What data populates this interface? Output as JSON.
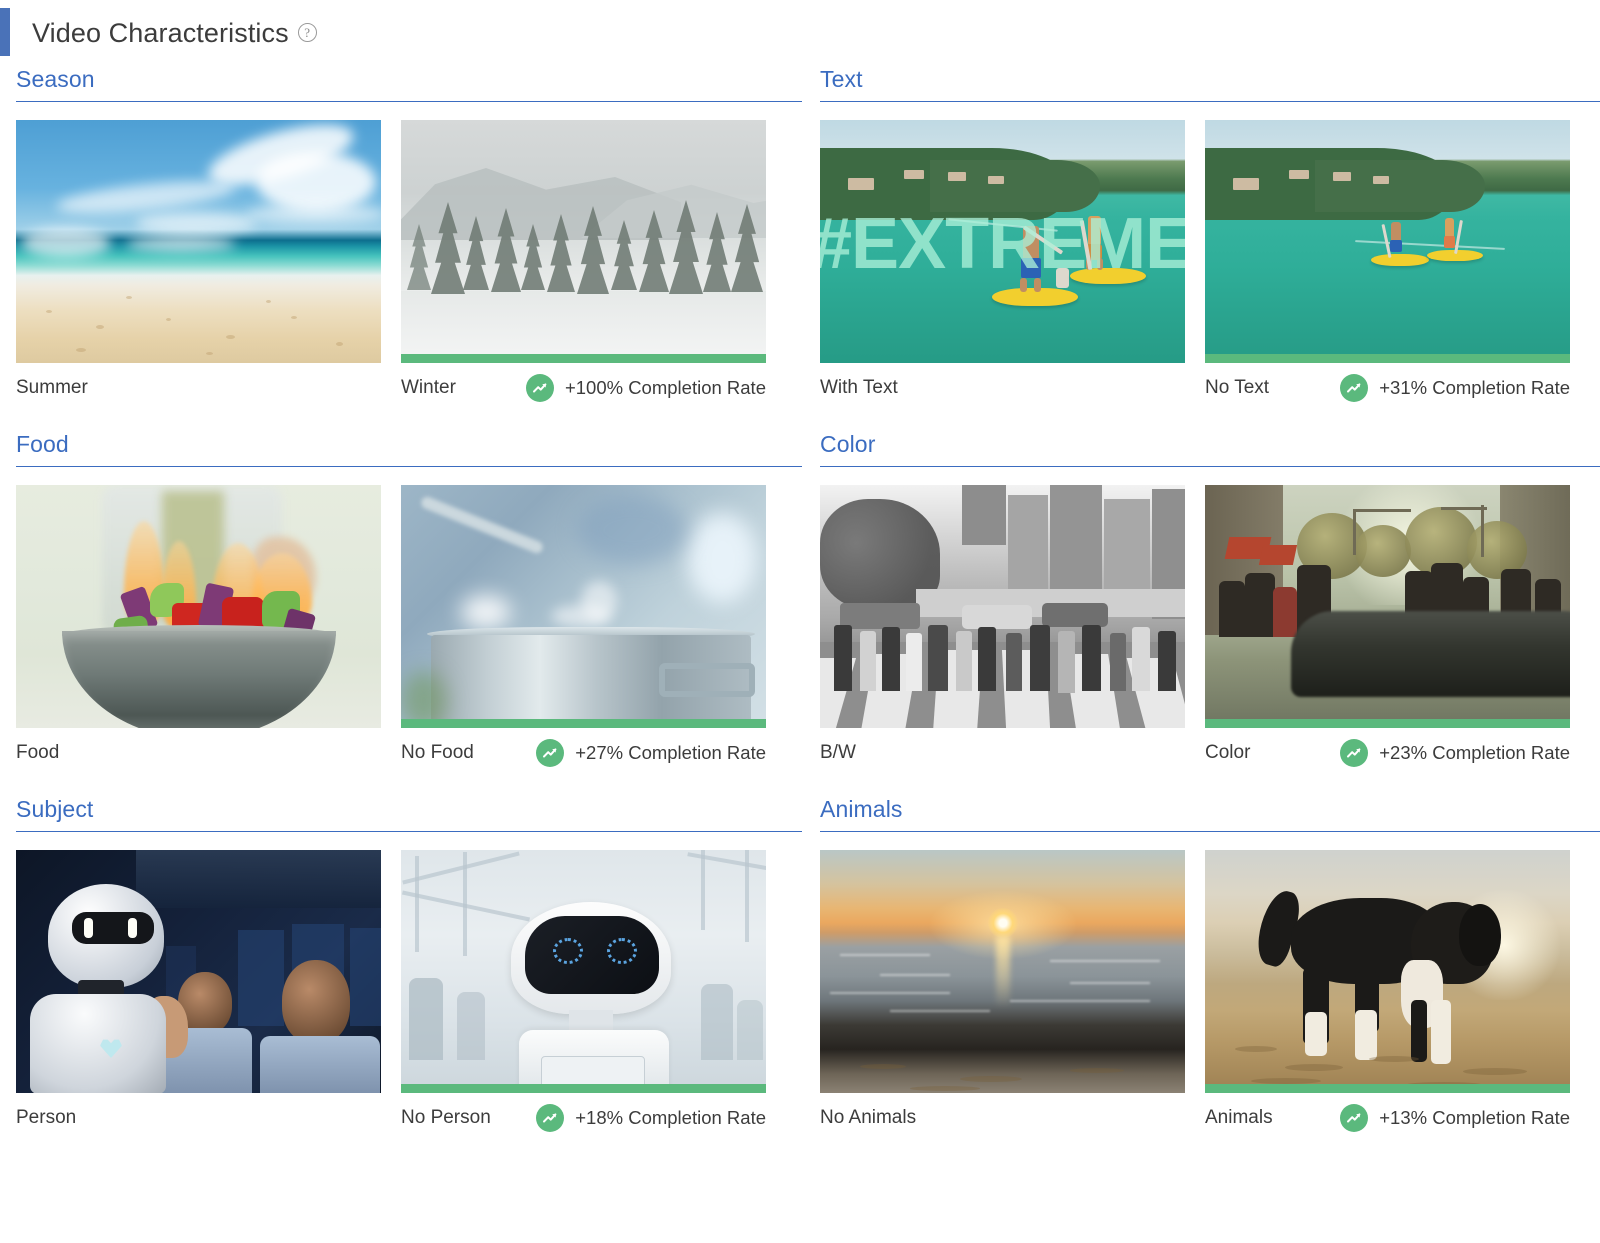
{
  "header": {
    "title": "Video Characteristics",
    "help_icon": "question-mark-icon",
    "accent_color": "#4a72b8"
  },
  "metric_suffix": "Completion Rate",
  "badge_icon": "trending-up-icon",
  "winner_bar_color": "#5bb97d",
  "section_title_color": "#3b6cc0",
  "sections": [
    {
      "id": "season",
      "title": "Season",
      "cards": [
        {
          "label": "Summer",
          "metric": "",
          "winner": false,
          "image": "beach-summer-thumbnail"
        },
        {
          "label": "Winter",
          "metric": "+100% Completion Rate",
          "winner": true,
          "image": "snowy-forest-winter-thumbnail"
        }
      ]
    },
    {
      "id": "text",
      "title": "Text",
      "cards": [
        {
          "label": "With Text",
          "metric": "",
          "winner": false,
          "image": "paddleboard-with-text-overlay-thumbnail",
          "overlay_text": "#EXTREME"
        },
        {
          "label": "No Text",
          "metric": "+31% Completion Rate",
          "winner": true,
          "image": "paddleboard-no-text-thumbnail"
        }
      ]
    },
    {
      "id": "food",
      "title": "Food",
      "cards": [
        {
          "label": "Food",
          "metric": "",
          "winner": false,
          "image": "flaming-wok-vegetables-thumbnail"
        },
        {
          "label": "No Food",
          "metric": "+27% Completion Rate",
          "winner": true,
          "image": "steaming-pot-thumbnail"
        }
      ]
    },
    {
      "id": "color",
      "title": "Color",
      "cards": [
        {
          "label": "B/W",
          "metric": "",
          "winner": false,
          "image": "black-white-crosswalk-thumbnail"
        },
        {
          "label": "Color",
          "metric": "+23% Completion Rate",
          "winner": true,
          "image": "color-street-car-thumbnail"
        }
      ]
    },
    {
      "id": "subject",
      "title": "Subject",
      "cards": [
        {
          "label": "Person",
          "metric": "",
          "winner": false,
          "image": "robot-with-people-dark-thumbnail"
        },
        {
          "label": "No Person",
          "metric": "+18% Completion Rate",
          "winner": true,
          "image": "white-robot-head-thumbnail"
        }
      ]
    },
    {
      "id": "animals",
      "title": "Animals",
      "cards": [
        {
          "label": "No Animals",
          "metric": "",
          "winner": false,
          "image": "sunset-ocean-thumbnail"
        },
        {
          "label": "Animals",
          "metric": "+13% Completion Rate",
          "winner": true,
          "image": "dog-on-beach-thumbnail"
        }
      ]
    }
  ]
}
